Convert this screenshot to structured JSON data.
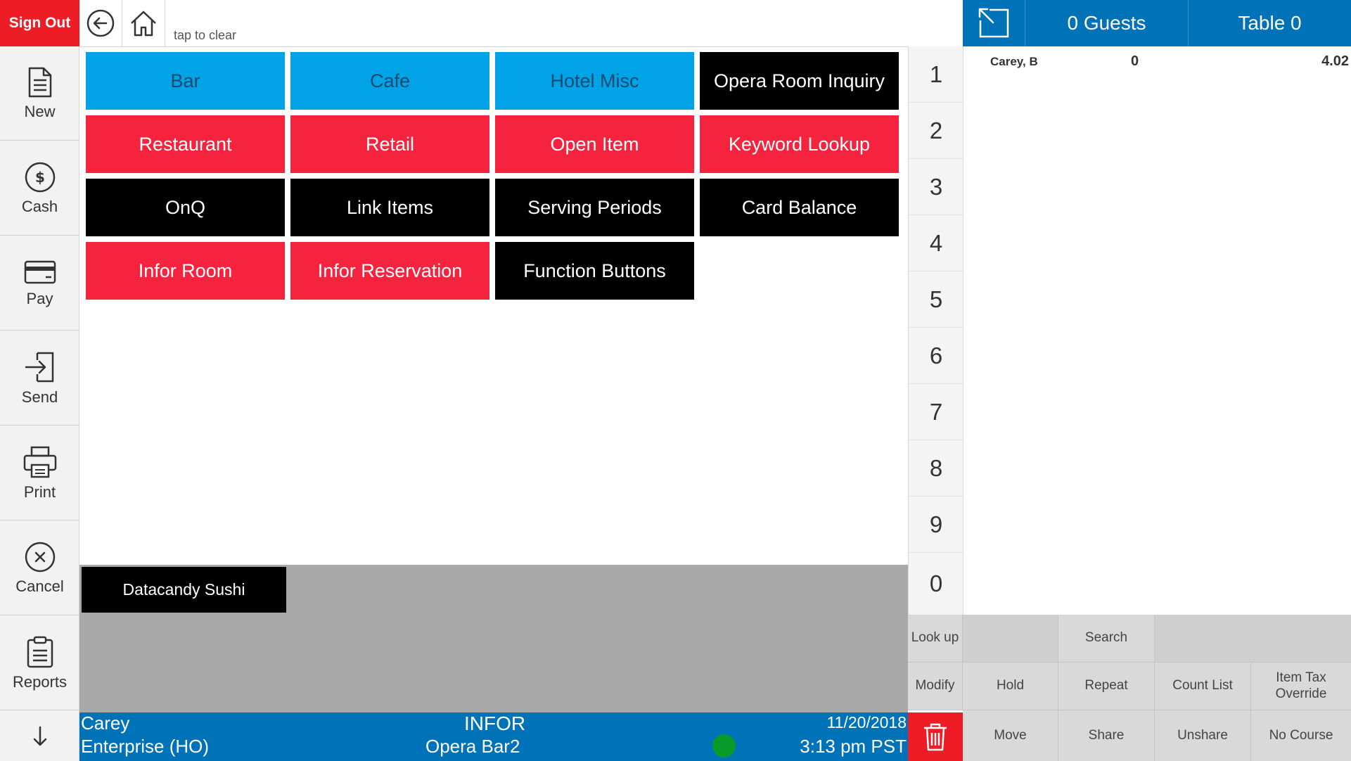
{
  "header": {
    "sign_out": "Sign Out",
    "tap_to_clear": "tap to clear",
    "back_icon": "back-arrow-icon",
    "home_icon": "home-icon"
  },
  "sidebar": {
    "items": [
      {
        "label": "New",
        "icon": "document-icon"
      },
      {
        "label": "Cash",
        "icon": "dollar-circle-icon"
      },
      {
        "label": "Pay",
        "icon": "credit-card-icon"
      },
      {
        "label": "Send",
        "icon": "send-icon"
      },
      {
        "label": "Print",
        "icon": "printer-icon"
      },
      {
        "label": "Cancel",
        "icon": "cancel-circle-icon"
      },
      {
        "label": "Reports",
        "icon": "clipboard-icon"
      }
    ],
    "scroll_icon": "down-arrow-icon"
  },
  "menu": {
    "buttons": [
      {
        "label": "Bar",
        "style": "blue"
      },
      {
        "label": "Cafe",
        "style": "blue"
      },
      {
        "label": "Hotel Misc",
        "style": "blue"
      },
      {
        "label": "Opera Room Inquiry",
        "style": "black"
      },
      {
        "label": "Restaurant",
        "style": "red"
      },
      {
        "label": "Retail",
        "style": "red"
      },
      {
        "label": "Open Item",
        "style": "red"
      },
      {
        "label": "Keyword Lookup",
        "style": "red"
      },
      {
        "label": "OnQ",
        "style": "black"
      },
      {
        "label": "Link Items",
        "style": "black"
      },
      {
        "label": "Serving Periods",
        "style": "black"
      },
      {
        "label": "Card Balance",
        "style": "black"
      },
      {
        "label": "Infor Room",
        "style": "red"
      },
      {
        "label": "Infor Reservation",
        "style": "red"
      },
      {
        "label": "Function Buttons",
        "style": "black"
      }
    ],
    "tray_button": "Datacandy Sushi"
  },
  "numpad": [
    "1",
    "2",
    "3",
    "4",
    "5",
    "6",
    "7",
    "8",
    "9",
    "0"
  ],
  "check": {
    "expand_icon": "expand-icon",
    "guests": "0 Guests",
    "table": "Table 0",
    "line": {
      "name": "Carey, B",
      "qty": "0",
      "amount": "4.02"
    }
  },
  "function_keys": {
    "row1": [
      "Look up",
      "",
      "Search",
      ""
    ],
    "row2": [
      "Modify",
      "Hold",
      "Repeat",
      "Count List",
      "Item Tax Override"
    ],
    "row3": [
      "Move",
      "Share",
      "Unshare",
      "No Course"
    ],
    "delete_icon": "trash-icon"
  },
  "status": {
    "user": "Carey",
    "enterprise": "Enterprise (HO)",
    "company": "INFOR",
    "terminal": "Opera Bar2",
    "date": "11/20/2018",
    "time": "3:13 pm PST"
  },
  "colors": {
    "accent_blue": "#0072b8",
    "sign_out_red": "#ee1c25",
    "menu_blue": "#00a3e6",
    "menu_red": "#f5233d",
    "online_green": "#0a9a2a"
  }
}
